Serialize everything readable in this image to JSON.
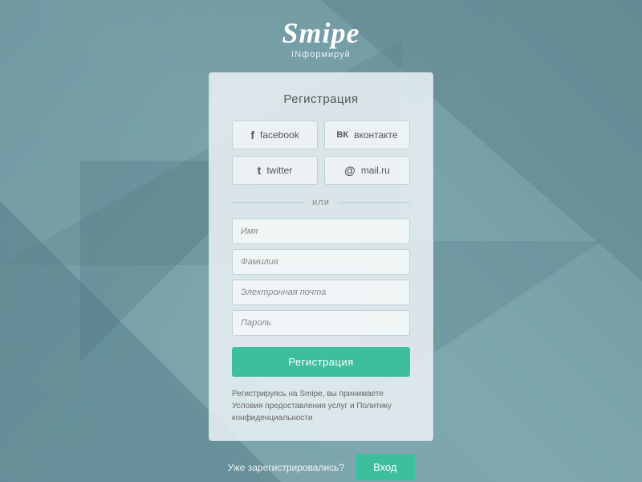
{
  "logo": {
    "title": "Smipe",
    "subtitle": "INформируй"
  },
  "card": {
    "title": "Регистрация"
  },
  "social_buttons": [
    {
      "id": "facebook",
      "icon": "f",
      "label": "facebook"
    },
    {
      "id": "vk",
      "icon": "вк",
      "label": "вконтакте"
    },
    {
      "id": "twitter",
      "icon": "t",
      "label": "twitter"
    },
    {
      "id": "mailru",
      "icon": "@",
      "label": "mail.ru"
    }
  ],
  "divider": {
    "text": "или"
  },
  "form": {
    "name_placeholder": "Имя",
    "surname_placeholder": "Фамилия",
    "email_placeholder": "Электронная почта",
    "password_placeholder": "Пароль"
  },
  "register_button": {
    "label": "Регистрация"
  },
  "terms": {
    "text": "Регистрируясь на Smipe, вы принимаете Условия предоставления услуг и Политику конфиденциальности"
  },
  "bottom": {
    "already_text": "Уже зарегистрировались?",
    "login_label": "Вход"
  }
}
